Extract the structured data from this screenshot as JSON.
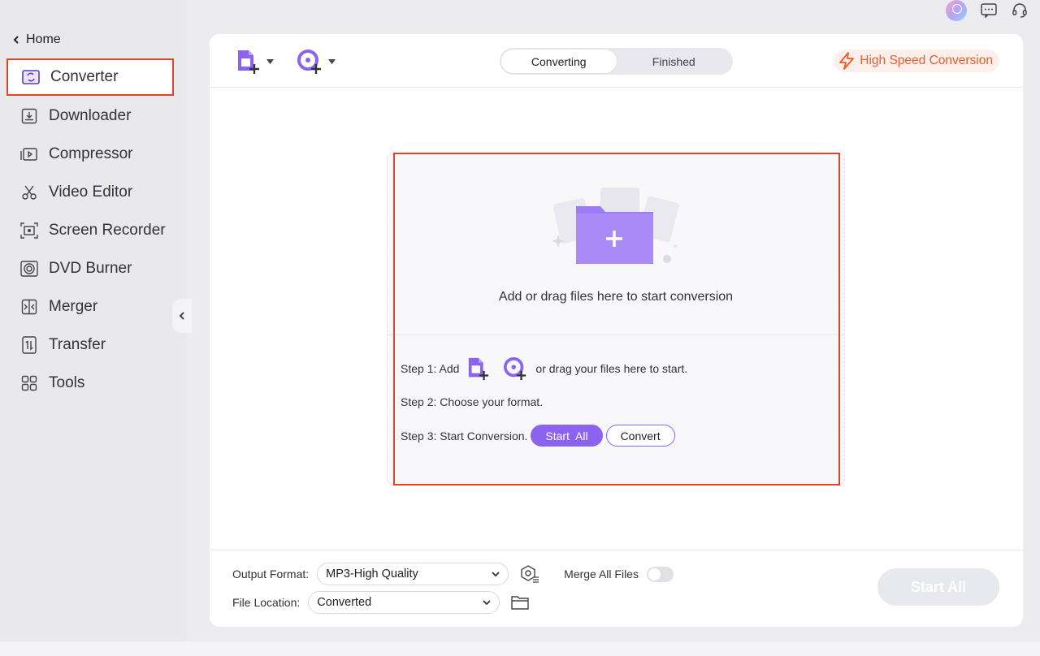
{
  "sidebar": {
    "home_label": "Home",
    "items": [
      {
        "label": "Converter",
        "icon": "converter-icon"
      },
      {
        "label": "Downloader",
        "icon": "download-icon"
      },
      {
        "label": "Compressor",
        "icon": "compress-icon"
      },
      {
        "label": "Video Editor",
        "icon": "scissors-icon"
      },
      {
        "label": "Screen Recorder",
        "icon": "screen-record-icon"
      },
      {
        "label": "DVD Burner",
        "icon": "disc-icon"
      },
      {
        "label": "Merger",
        "icon": "merge-icon"
      },
      {
        "label": "Transfer",
        "icon": "transfer-icon"
      },
      {
        "label": "Tools",
        "icon": "tools-grid-icon"
      }
    ]
  },
  "toolbar": {
    "tabs": [
      "Converting",
      "Finished"
    ],
    "active_tab": "Converting",
    "high_speed_label": "High Speed Conversion"
  },
  "dropzone": {
    "message": "Add or drag files here to start conversion",
    "step1_prefix": "Step 1: Add",
    "step1_suffix": "or drag your files here to start.",
    "step2": "Step 2: Choose your format.",
    "step3": "Step 3: Start Conversion.",
    "start_all_label": "Start  All",
    "convert_label": "Convert"
  },
  "footer": {
    "output_format_label": "Output Format:",
    "output_format_value": "MP3-High Quality",
    "merge_label": "Merge All Files",
    "file_location_label": "File Location:",
    "file_location_value": "Converted",
    "start_all_label": "Start All"
  },
  "colors": {
    "accent": "#8b63f0",
    "highlight": "#e0442b",
    "high_speed": "#f05a28"
  }
}
